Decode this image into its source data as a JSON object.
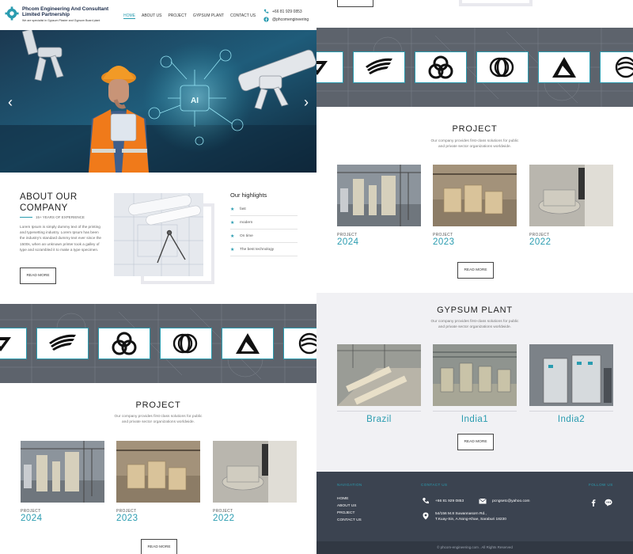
{
  "brand": {
    "name": "Phcom Engineering And Consultant Limited Partnership",
    "tagline": "We are specialist in Gypsum Plaster and Gypsum Board plant"
  },
  "nav": {
    "items": [
      "HOME",
      "ABOUT US",
      "PROJECT",
      "GYPSUM PLANT",
      "CONTACT US"
    ],
    "active": "HOME"
  },
  "header_contact": {
    "phone": "+66 81 929 0853",
    "facebook": "@phcomengineering"
  },
  "about": {
    "title": "ABOUT OUR COMPANY",
    "experience": "15+ YEARS OF EXPERIENCE",
    "body": "Lorem Ipsum is simply dummy text of the printing and typesetting industry. Lorem Ipsum has been the industry's standard dummy text ever since the 1500s, when an unknown printer took a galley of type and scrambled it to make a type specimen.",
    "button": "READ MORE"
  },
  "highlights": {
    "title": "Our highlights",
    "items": [
      "fast",
      "modern",
      "On time",
      "The best technology"
    ]
  },
  "project": {
    "title": "PROJECT",
    "subtitle_line1": "Our company provides first-class solutions for public",
    "subtitle_line2": "and private sector organizations worldwide.",
    "label": "PROJECT",
    "years": [
      "2024",
      "2023",
      "2022"
    ],
    "button": "READ MORE"
  },
  "gypsum_plant": {
    "title": "GYPSUM PLANT",
    "subtitle_line1": "Our company provides first-class solutions for public",
    "subtitle_line2": "and private sector organizations worldwide.",
    "plants": [
      "Brazil",
      "India1",
      "India2"
    ],
    "button": "READ MORE"
  },
  "footer": {
    "nav_heading": "NAVIGATION",
    "nav_links": [
      "HOME",
      "ABOUT US",
      "PROJECT",
      "CONTACT US"
    ],
    "contact_heading": "CONTACT US",
    "phone": "+66 81 929 0853",
    "email": "pcngsetc@yahoo.com",
    "address_line1": "54/156 M.8 Suwannasorn Rd.,",
    "address_line2": "T.Kuay-Sin, A.Nong-Khae, Saraburi 18230",
    "follow_heading": "FOLLOW US",
    "copyright": "© phcom-engineering.com . All Rights Reserved"
  },
  "colors": {
    "accent": "#2a9cb0",
    "footer_bg": "#3b4350",
    "navy": "#1a2b4a"
  }
}
